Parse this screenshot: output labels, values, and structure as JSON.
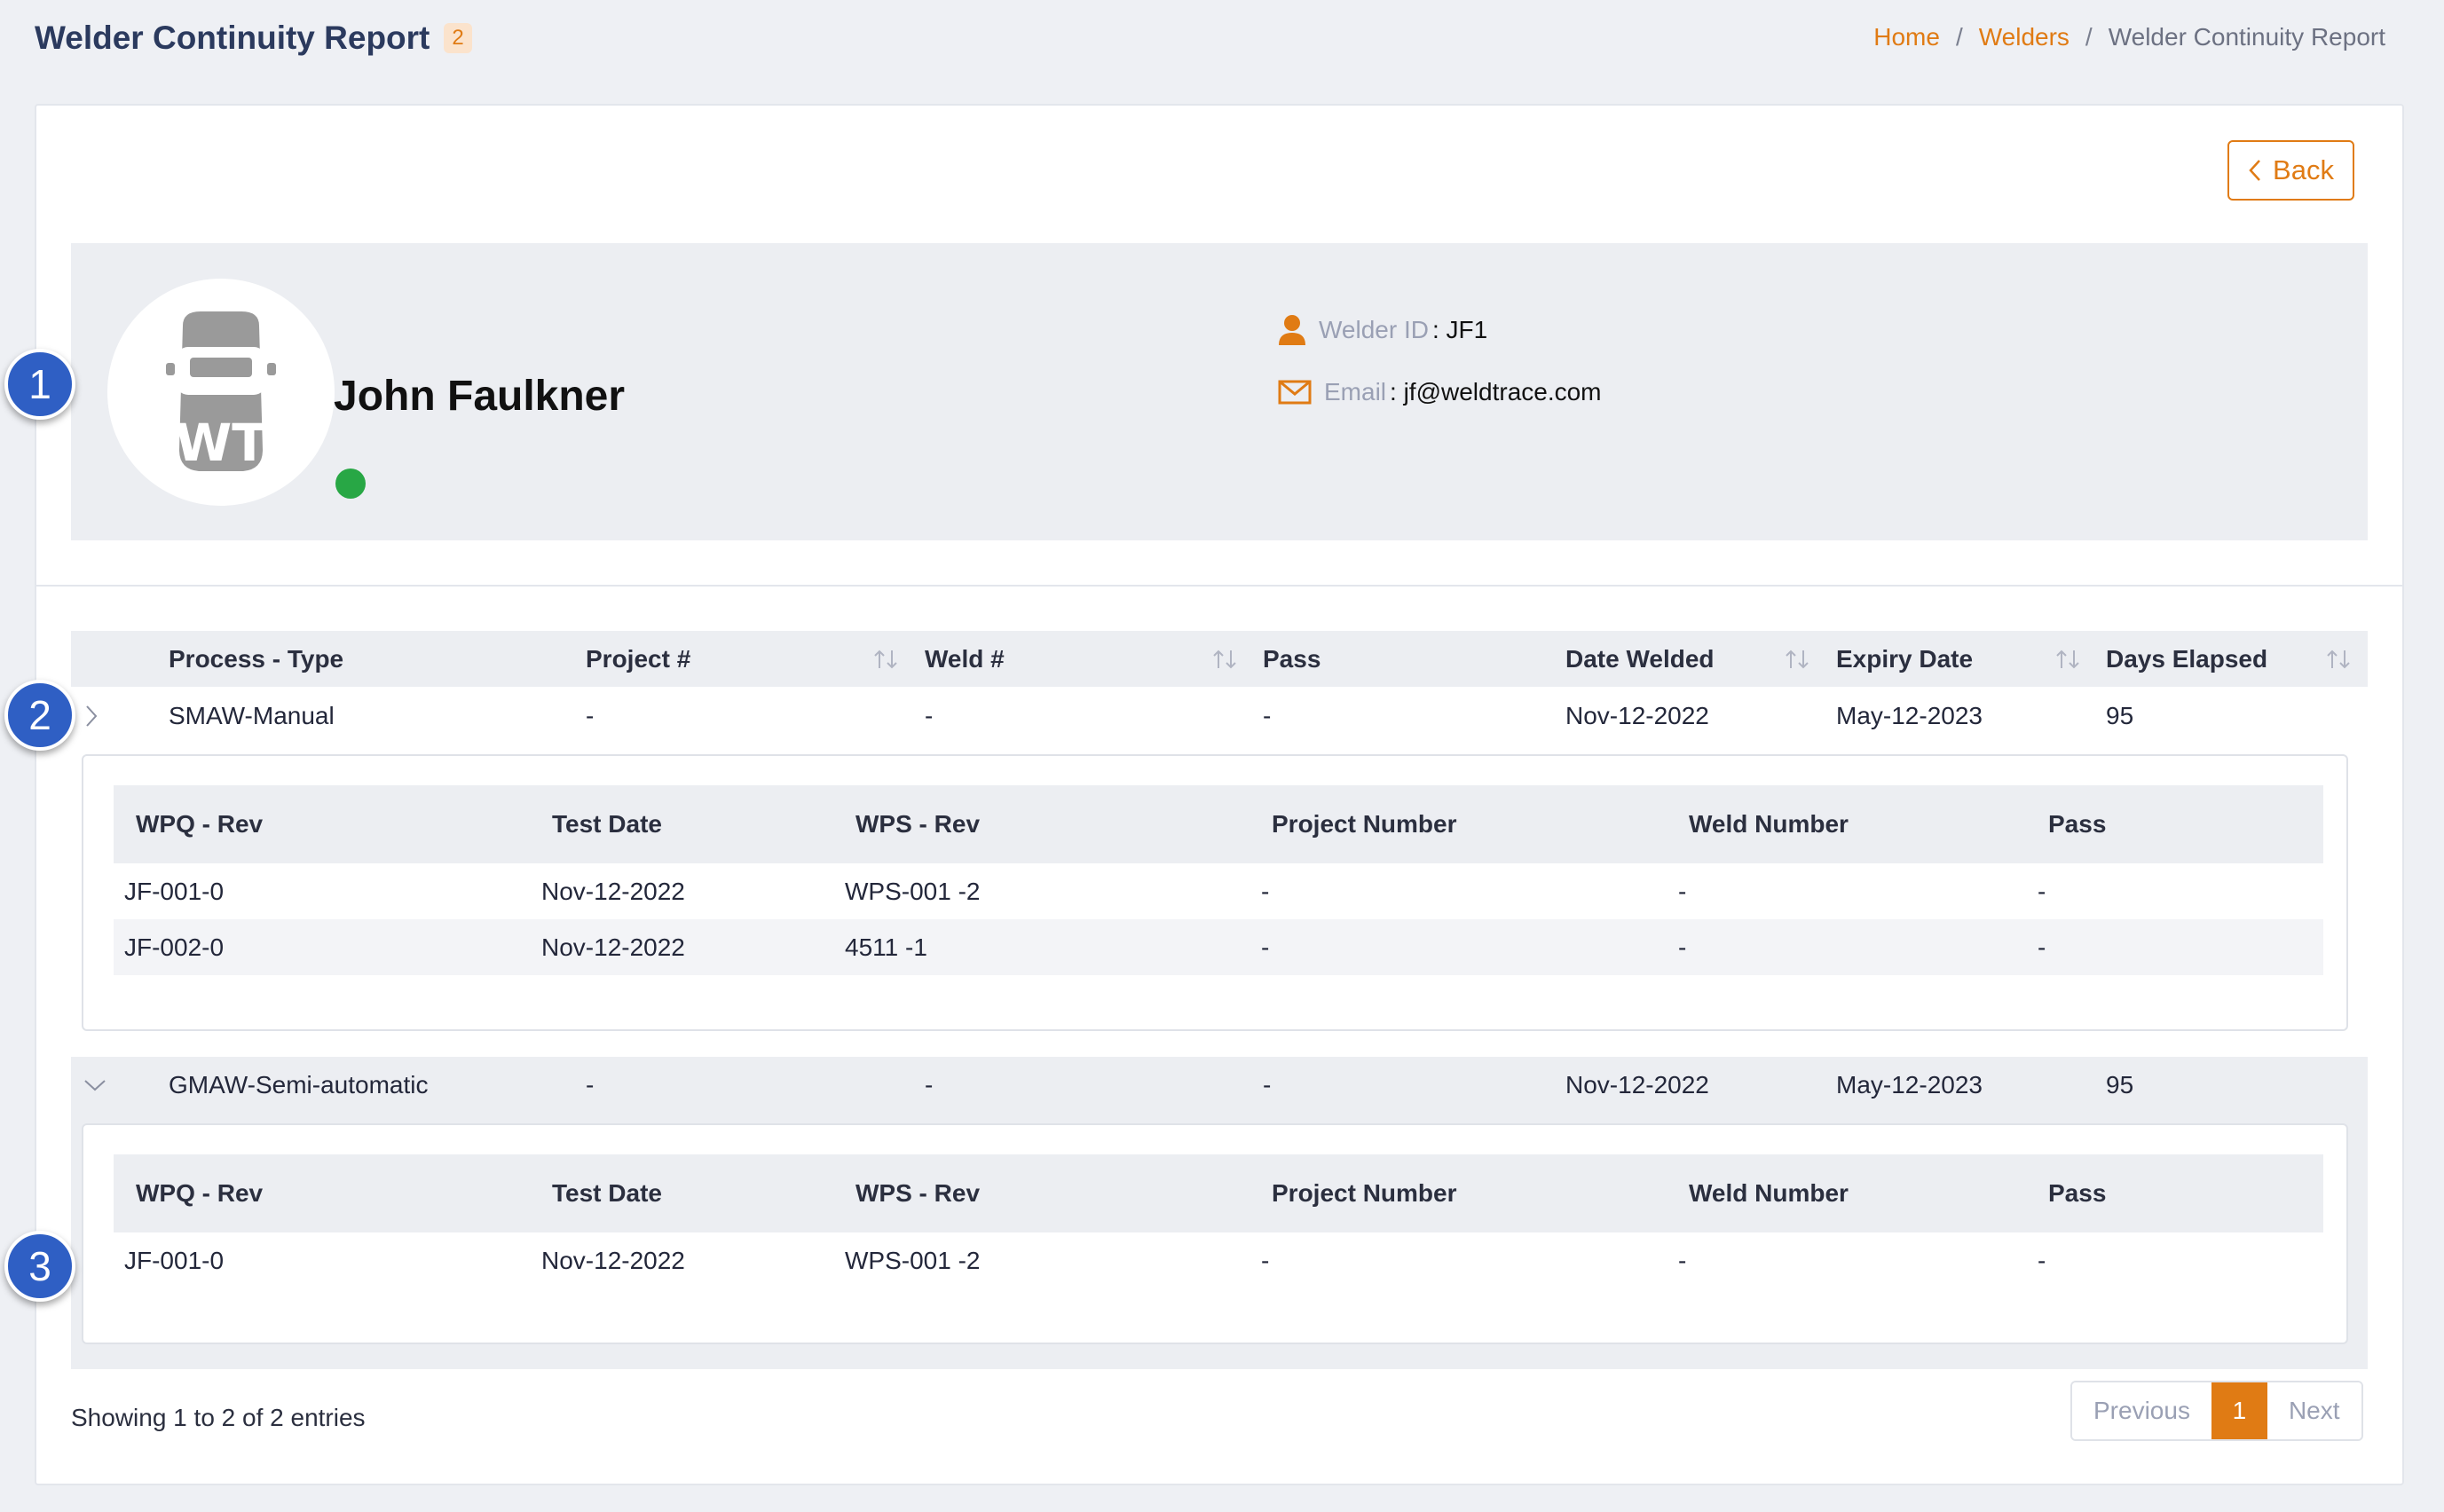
{
  "header": {
    "title": "Welder Continuity Report",
    "count": "2",
    "breadcrumb": {
      "home": "Home",
      "sep": "/",
      "welders": "Welders",
      "current": "Welder Continuity Report"
    }
  },
  "back_label": "Back",
  "profile": {
    "name": "John Faulkner",
    "avatar_text": "WT",
    "welder_id_label": "Welder ID",
    "welder_id": ": JF1",
    "email_label": "Email",
    "email": ": jf@weldtrace.com",
    "status_color": "#28a745"
  },
  "table": {
    "headers": [
      "Process - Type",
      "Project #",
      "Weld #",
      "Pass",
      "Date Welded",
      "Expiry Date",
      "Days Elapsed"
    ],
    "rows": [
      {
        "process": "SMAW-Manual",
        "project": "-",
        "weld": "-",
        "pass": "-",
        "date_welded": "Nov-12-2022",
        "expiry": "May-12-2023",
        "days": "95"
      },
      {
        "process": "GMAW-Semi-automatic",
        "project": "-",
        "weld": "-",
        "pass": "-",
        "date_welded": "Nov-12-2022",
        "expiry": "May-12-2023",
        "days": "95"
      }
    ]
  },
  "child_table": {
    "headers": [
      "WPQ - Rev",
      "Test Date",
      "WPS - Rev",
      "Project Number",
      "Weld Number",
      "Pass"
    ],
    "group1": [
      {
        "wpq": "JF-001-0",
        "test_date": "Nov-12-2022",
        "wps": "WPS-001 -2",
        "project": "-",
        "weld": "-",
        "pass": "-"
      },
      {
        "wpq": "JF-002-0",
        "test_date": "Nov-12-2022",
        "wps": "4511 -1",
        "project": "-",
        "weld": "-",
        "pass": "-"
      }
    ],
    "group2": [
      {
        "wpq": "JF-001-0",
        "test_date": "Nov-12-2022",
        "wps": "WPS-001 -2",
        "project": "-",
        "weld": "-",
        "pass": "-"
      }
    ]
  },
  "footer": {
    "showing": "Showing 1 to 2 of 2 entries",
    "previous": "Previous",
    "page": "1",
    "next": "Next"
  },
  "callouts": [
    "1",
    "2",
    "3"
  ],
  "colors": {
    "accent": "#e07b14",
    "badge": "#2f5fc4",
    "header_bg": "#eceef2"
  }
}
